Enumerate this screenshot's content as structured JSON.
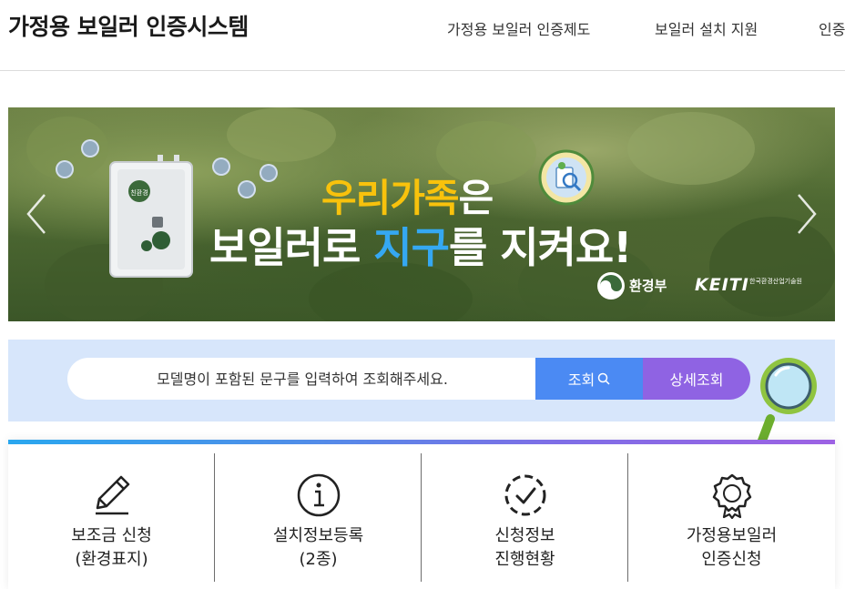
{
  "header": {
    "site_title": "가정용 보일러 인증시스템",
    "nav": [
      {
        "label": "가정용 보일러 인증제도"
      },
      {
        "label": "보일러 설치 지원"
      },
      {
        "label": "인증"
      }
    ]
  },
  "banner": {
    "headline_part1": "우리가족",
    "headline_part2": "은",
    "headline2_part1": "보일러로 ",
    "headline2_part2": "지구",
    "headline2_part3": "를 지켜요!",
    "boiler_label": "친환경",
    "logo_moe": "환경부",
    "logo_keiti": "KEITI",
    "logo_keiti_sub": "한국환경산업기술원",
    "colors": {
      "yellow": "#f8c20c",
      "blue": "#35a8f2"
    }
  },
  "search": {
    "placeholder": "모델명이 포함된 문구를 입력하여 조회해주세요.",
    "search_button": "조회",
    "detail_button": "상세조회",
    "colors": {
      "search": "#4b8af3",
      "detail": "#8f63e3",
      "panel": "#d7e6fb"
    }
  },
  "services": [
    {
      "icon": "pencil-icon",
      "line1": "보조금 신청",
      "line2": "(환경표지)"
    },
    {
      "icon": "info-icon",
      "line1": "설치정보등록",
      "line2": "(2종)"
    },
    {
      "icon": "progress-check-icon",
      "line1": "신청정보",
      "line2": "진행현황"
    },
    {
      "icon": "award-icon",
      "line1": "가정용보일러",
      "line2": "인증신청"
    }
  ]
}
